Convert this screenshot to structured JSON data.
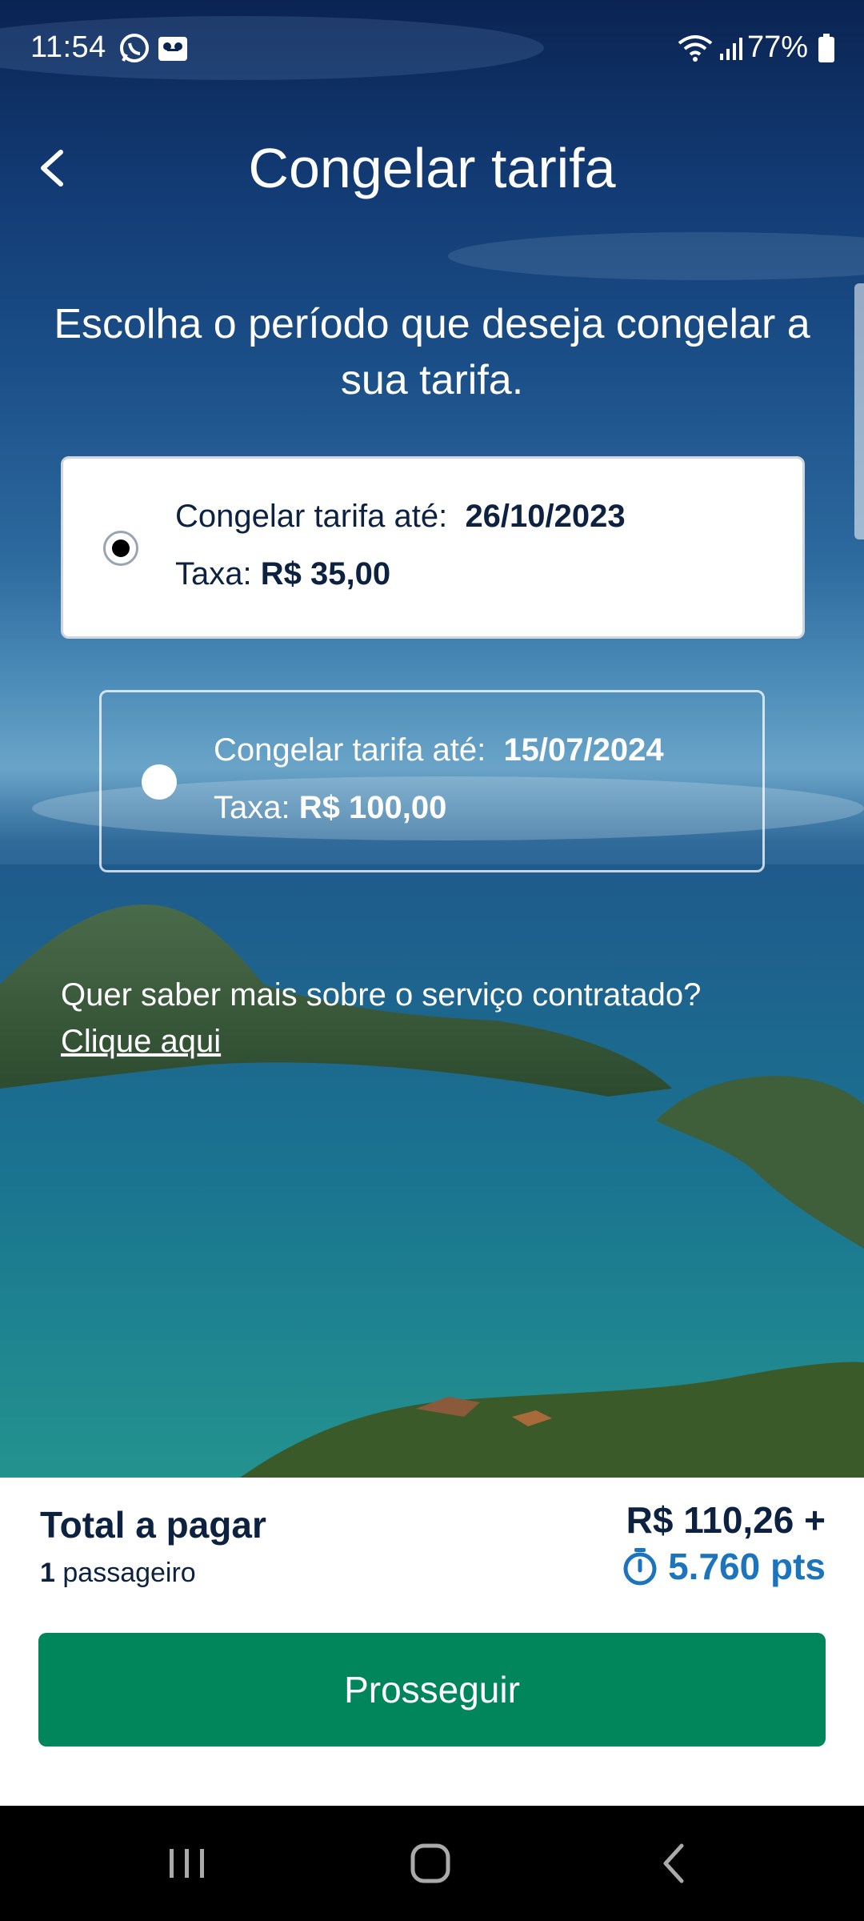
{
  "status_bar": {
    "time": "11:54",
    "battery": "77%"
  },
  "header": {
    "title": "Congelar tarifa"
  },
  "subtitle": "Escolha o período que deseja congelar a sua tarifa.",
  "options": [
    {
      "label": "Congelar tarifa até:",
      "date": "26/10/2023",
      "fee_label": "Taxa:",
      "fee": "R$ 35,00",
      "selected": true
    },
    {
      "label": "Congelar tarifa até:",
      "date": "15/07/2024",
      "fee_label": "Taxa:",
      "fee": "R$ 100,00",
      "selected": false
    }
  ],
  "info": {
    "question": "Quer saber mais sobre o serviço contratado?",
    "link": "Clique aqui"
  },
  "summary": {
    "total_label": "Total a pagar",
    "passenger_count": "1",
    "passenger_label": "passageiro",
    "price": "R$ 110,26 +",
    "points": "5.760 pts"
  },
  "actions": {
    "proceed": "Prosseguir"
  },
  "colors": {
    "primary_button": "#00865a",
    "points_blue": "#1c75bc",
    "text_dark": "#0d2240"
  },
  "icons": [
    "whatsapp-icon",
    "voicemail-icon",
    "wifi-icon",
    "signal-icon",
    "battery-icon",
    "back-arrow-icon",
    "timer-icon",
    "recents-icon",
    "home-icon",
    "nav-back-icon"
  ]
}
